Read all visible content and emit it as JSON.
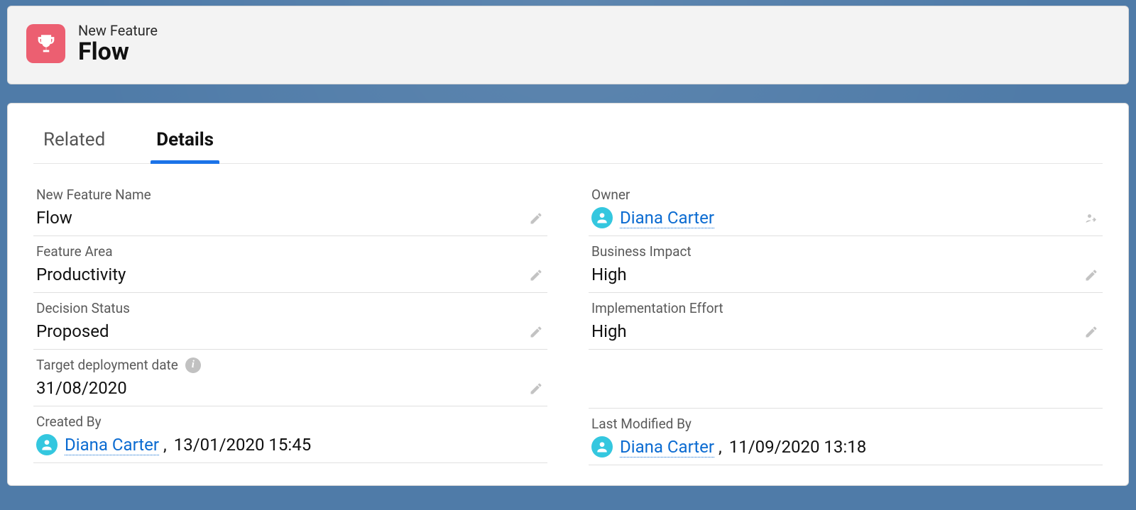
{
  "header": {
    "object_label": "New Feature",
    "record_title": "Flow"
  },
  "tabs": {
    "related": "Related",
    "details": "Details"
  },
  "fields": {
    "name": {
      "label": "New Feature Name",
      "value": "Flow"
    },
    "feature_area": {
      "label": "Feature Area",
      "value": "Productivity"
    },
    "decision_status": {
      "label": "Decision Status",
      "value": "Proposed"
    },
    "target_date": {
      "label": "Target deployment date",
      "value": "31/08/2020"
    },
    "created_by": {
      "label": "Created By",
      "user": "Diana Carter",
      "timestamp": "13/01/2020 15:45"
    },
    "owner": {
      "label": "Owner",
      "user": "Diana Carter"
    },
    "business_impact": {
      "label": "Business Impact",
      "value": "High"
    },
    "impl_effort": {
      "label": "Implementation Effort",
      "value": "High"
    },
    "last_modified": {
      "label": "Last Modified By",
      "user": "Diana Carter",
      "timestamp": "11/09/2020 13:18"
    }
  }
}
